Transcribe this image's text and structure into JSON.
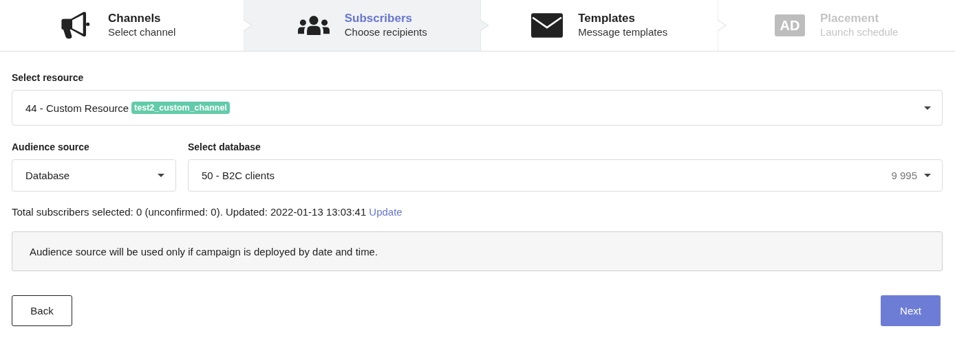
{
  "steps": [
    {
      "kind": "megaphone",
      "title": "Channels",
      "subtitle": "Select channel",
      "selected": false,
      "disabled": false
    },
    {
      "kind": "users",
      "title": "Subscribers",
      "subtitle": "Choose recipients",
      "selected": true,
      "disabled": false
    },
    {
      "kind": "envelope",
      "title": "Templates",
      "subtitle": "Message templates",
      "selected": false,
      "disabled": false
    },
    {
      "kind": "ad",
      "icon_text": "AD",
      "title": "Placement",
      "subtitle": "Launch schedule",
      "selected": false,
      "disabled": true
    }
  ],
  "resource": {
    "label": "Select resource",
    "value": "44 - Custom Resource",
    "tag": "test2_custom_channel"
  },
  "audience": {
    "label": "Audience source",
    "value": "Database"
  },
  "database": {
    "label": "Select database",
    "value": "50 - B2C clients",
    "count": "9 995"
  },
  "summary": {
    "text": "Total subscribers selected: 0 (unconfirmed: 0). Updated: 2022-01-13 13:03:41",
    "link": "Update"
  },
  "notice": "Audience source will be used only if campaign is deployed by date and time.",
  "buttons": {
    "back": "Back",
    "next": "Next"
  }
}
